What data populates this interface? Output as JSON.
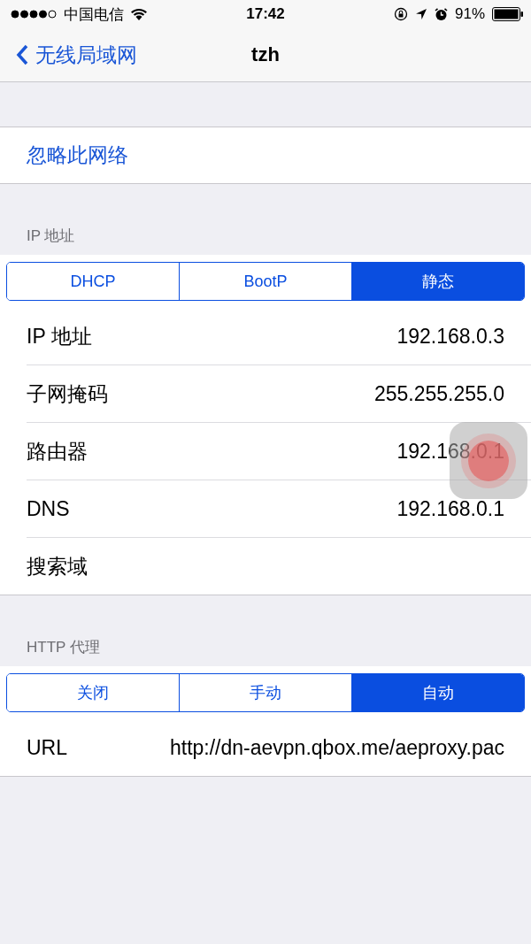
{
  "status_bar": {
    "carrier": "中国电信",
    "time": "17:42",
    "battery": "91%"
  },
  "nav": {
    "back": "无线局域网",
    "title": "tzh"
  },
  "forget": "忽略此网络",
  "ip": {
    "header": "IP 地址",
    "modes": [
      {
        "label": "DHCP",
        "selected": false
      },
      {
        "label": "BootP",
        "selected": false
      },
      {
        "label": "静态",
        "selected": true
      }
    ],
    "rows": [
      {
        "label": "IP 地址",
        "value": "192.168.0.3"
      },
      {
        "label": "子网掩码",
        "value": "255.255.255.0"
      },
      {
        "label": "路由器",
        "value": "192.168.0.1"
      },
      {
        "label": "DNS",
        "value": "192.168.0.1"
      },
      {
        "label": "搜索域"
      }
    ]
  },
  "proxy": {
    "header": "HTTP 代理",
    "modes": [
      {
        "label": "关闭",
        "selected": false
      },
      {
        "label": "手动",
        "selected": false
      },
      {
        "label": "自动",
        "selected": true
      }
    ],
    "rows": [
      {
        "label": "URL",
        "value": "http://dn-aevpn.qbox.me/aeproxy.pac"
      }
    ]
  }
}
